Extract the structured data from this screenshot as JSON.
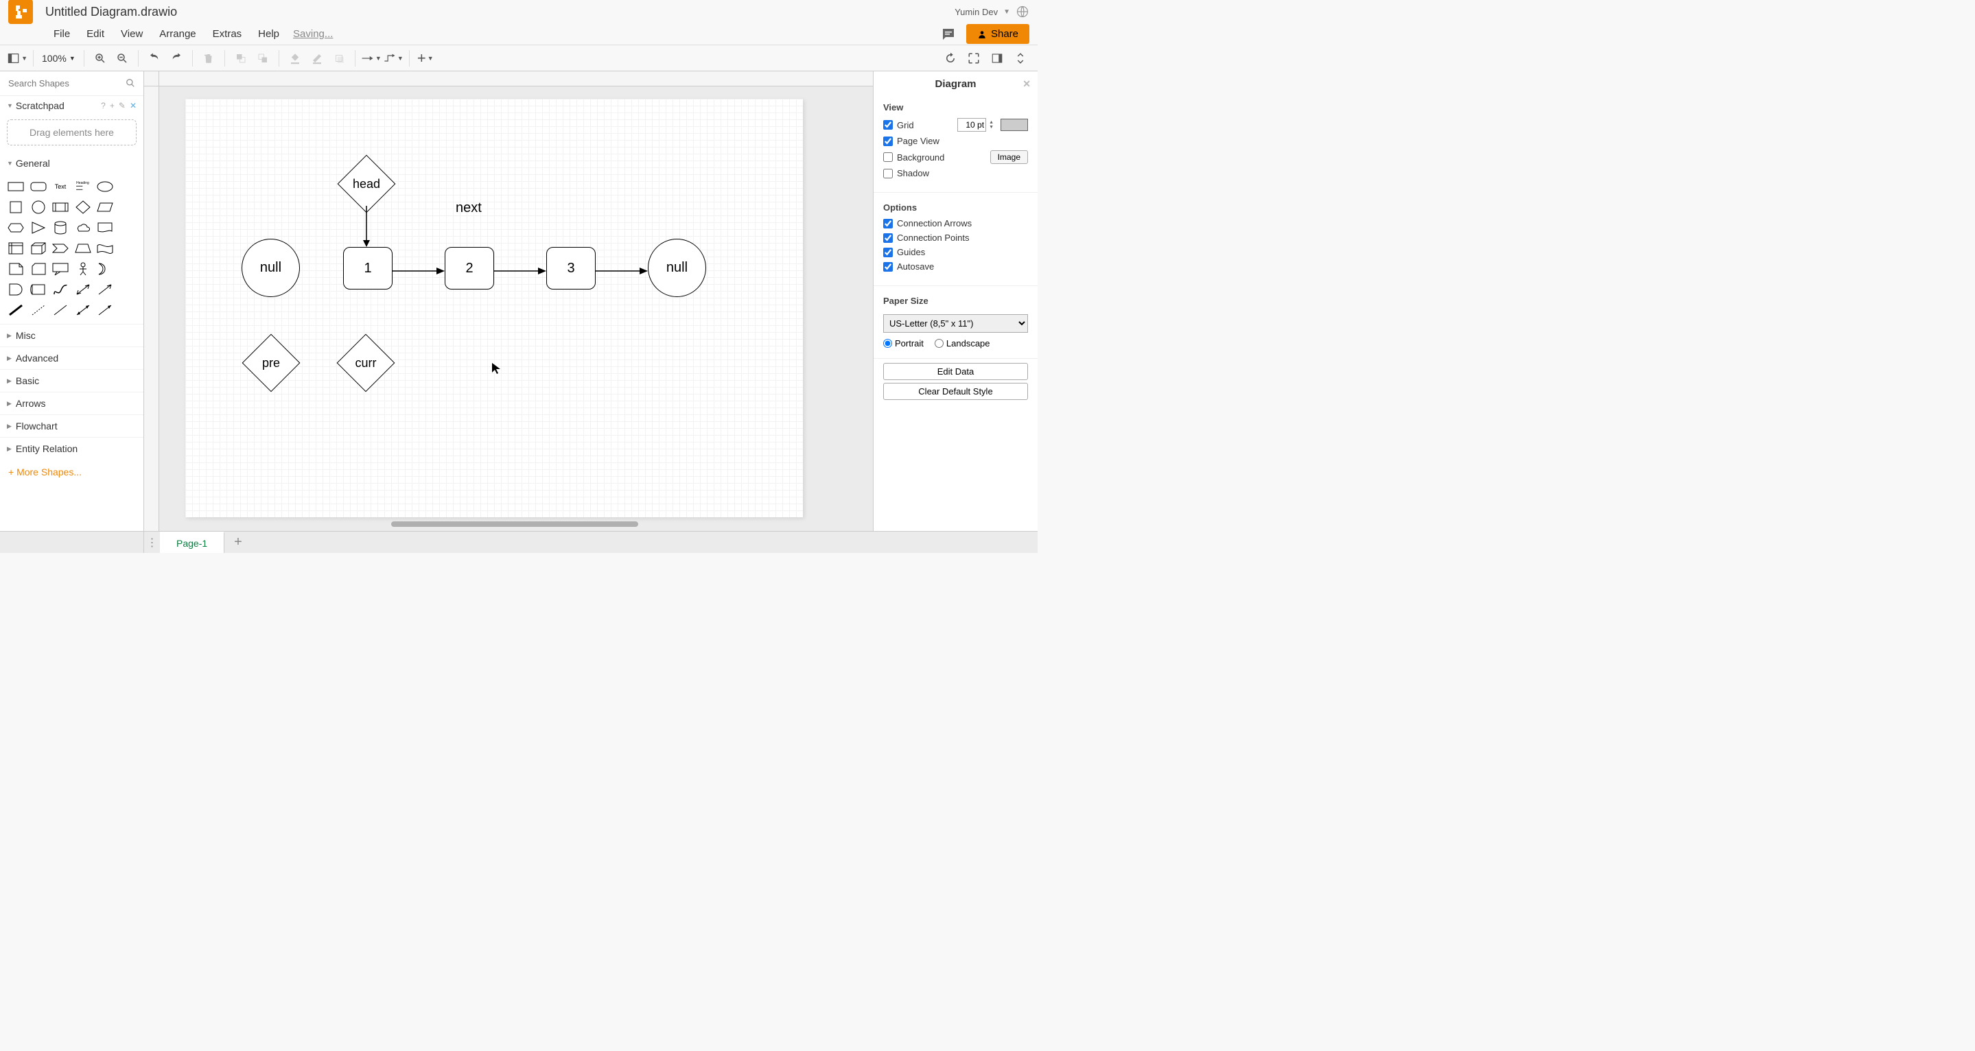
{
  "header": {
    "doc_title": "Untitled Diagram.drawio",
    "user": "Yumin Dev",
    "share": "Share",
    "saving": "Saving..."
  },
  "menus": [
    "File",
    "Edit",
    "View",
    "Arrange",
    "Extras",
    "Help"
  ],
  "toolbar": {
    "zoom": "100%"
  },
  "sidebar": {
    "search_placeholder": "Search Shapes",
    "scratchpad": "Scratchpad",
    "scratchpad_hint": "Drag elements here",
    "general": "General",
    "sections": [
      "Misc",
      "Advanced",
      "Basic",
      "Arrows",
      "Flowchart",
      "Entity Relation"
    ],
    "more": "+ More Shapes..."
  },
  "canvas": {
    "nodes": {
      "head": "head",
      "null1": "null",
      "n1": "1",
      "n2": "2",
      "n3": "3",
      "null2": "null",
      "pre": "pre",
      "curr": "curr",
      "next_label": "next"
    }
  },
  "right": {
    "title": "Diagram",
    "view_h": "View",
    "grid": "Grid",
    "grid_size": "10 pt",
    "page_view": "Page View",
    "background": "Background",
    "image_btn": "Image",
    "shadow": "Shadow",
    "options_h": "Options",
    "conn_arrows": "Connection Arrows",
    "conn_points": "Connection Points",
    "guides": "Guides",
    "autosave": "Autosave",
    "paper_h": "Paper Size",
    "paper_val": "US-Letter (8,5\" x 11\")",
    "portrait": "Portrait",
    "landscape": "Landscape",
    "edit_data": "Edit Data",
    "clear_style": "Clear Default Style"
  },
  "footer": {
    "page1": "Page-1"
  }
}
